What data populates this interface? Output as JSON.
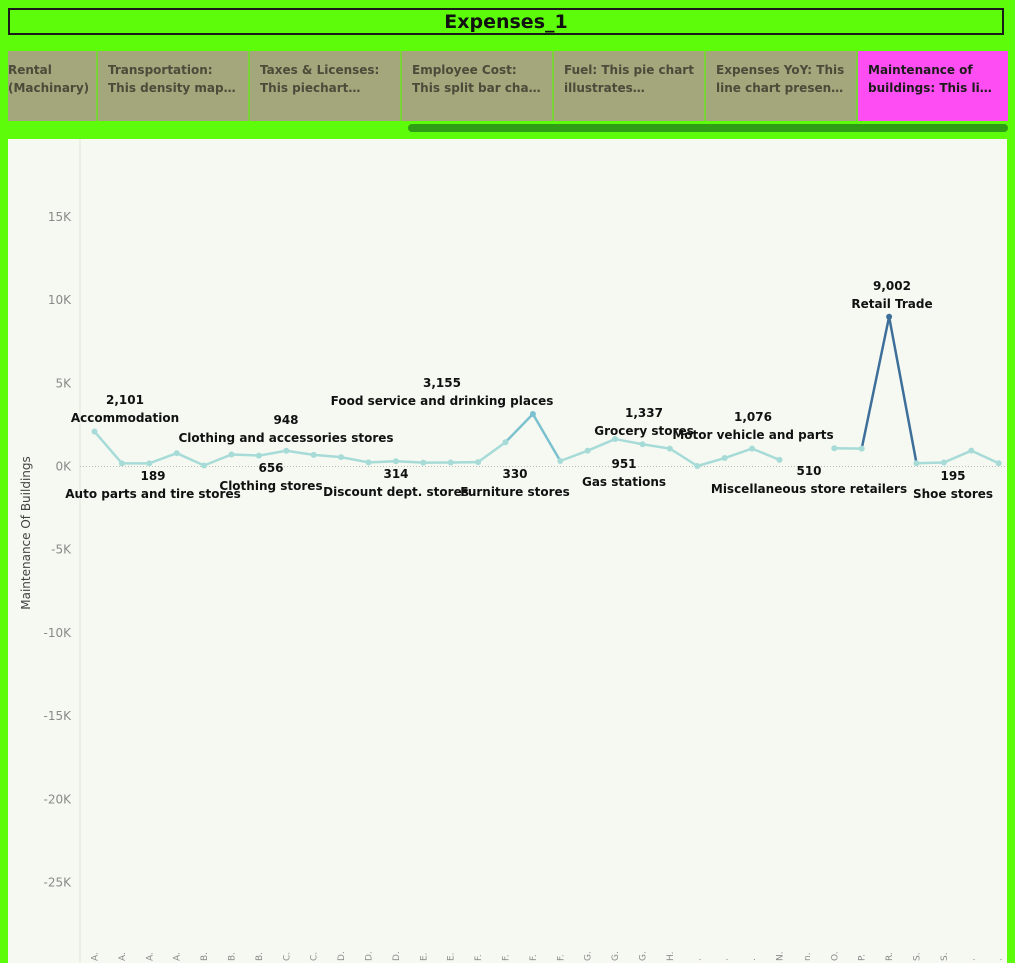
{
  "dashboard": {
    "title": "Expenses_1"
  },
  "tabs": [
    {
      "label": "Rental (Machinary):..",
      "active": false
    },
    {
      "label": "Transportation: This density map portrays ..",
      "active": false
    },
    {
      "label": "Taxes & Licenses: This piechart illustrates t..",
      "active": false
    },
    {
      "label": "Employee Cost: This split bar chart provid..",
      "active": false
    },
    {
      "label": "Fuel: This pie chart illustrates expenditur..",
      "active": false
    },
    {
      "label": "Expenses YoY: This line chart presents the ex..",
      "active": false
    },
    {
      "label": "Maintenance of buildings: This line ch..",
      "active": true
    }
  ],
  "colors": {
    "light_line": "#a6dbd8",
    "mid_line": "#7cc1cf",
    "dark_line": "#3d6f9a"
  },
  "chart_data": {
    "type": "line",
    "ylabel": "Maintenance Of Buildings",
    "ylim": [
      -30000,
      18000
    ],
    "yticks": [
      15000,
      10000,
      5000,
      0,
      -5000,
      -10000,
      -15000,
      -20000,
      -25000
    ],
    "ytick_labels": [
      "15K",
      "10K",
      "5K",
      "0K",
      "-5K",
      "-10K",
      "-15K",
      "-20K",
      "-25K"
    ],
    "grid": false,
    "zero_line": "dotted",
    "x_tick_labels": [
      "A.",
      "A.",
      "A.",
      "A.",
      "B.",
      "B.",
      "B.",
      "C.",
      "C.",
      "D.",
      "D.",
      "D.",
      "E.",
      "E.",
      "F.",
      "F.",
      "F.",
      "F.",
      "G.",
      "G.",
      "G.",
      "H.",
      ".",
      ".",
      ".",
      "N.",
      "n.",
      "O.",
      "P.",
      "R.",
      "S.",
      "S.",
      ".",
      "."
    ],
    "values": [
      2101,
      189,
      189,
      800,
      60,
      720,
      656,
      948,
      700,
      560,
      250,
      314,
      230,
      240,
      260,
      1460,
      3155,
      330,
      951,
      1650,
      1337,
      1076,
      30,
      510,
      1076,
      400,
      null,
      1100,
      1076,
      9002,
      195,
      240,
      951,
      195
    ],
    "point_labels": [
      {
        "index": 0,
        "value": "2,101",
        "name": "Accommodation",
        "position": "above"
      },
      {
        "index": 2,
        "value": "189",
        "name": "Auto parts and tire stores",
        "position": "below-name-under"
      },
      {
        "index": 7,
        "value": "948",
        "name": "Clothing and accessories stores",
        "position": "above"
      },
      {
        "index": 6,
        "value": "656",
        "name": "Clothing stores",
        "position": "below"
      },
      {
        "index": 16,
        "value": "3,155",
        "name": "Food service and drinking places",
        "position": "above"
      },
      {
        "index": 11,
        "value": "314",
        "name": "Discount dept. stores",
        "position": "below"
      },
      {
        "index": 17,
        "value": "330",
        "name": "Furniture stores",
        "position": "below"
      },
      {
        "index": 20,
        "value": "1,337",
        "name": "Grocery stores",
        "position": "above"
      },
      {
        "index": 18,
        "value": "951",
        "name": "Gas stations",
        "position": "below"
      },
      {
        "index": 24,
        "value": "1,076",
        "name": "Motor vehicle and parts",
        "position": "above"
      },
      {
        "index": 25,
        "value": "510",
        "name": "Miscellaneous store retailers",
        "position": "below"
      },
      {
        "index": 29,
        "value": "9,002",
        "name": "Retail Trade",
        "position": "above"
      },
      {
        "index": 31,
        "value": "195",
        "name": "Shoe stores",
        "position": "below"
      }
    ]
  }
}
